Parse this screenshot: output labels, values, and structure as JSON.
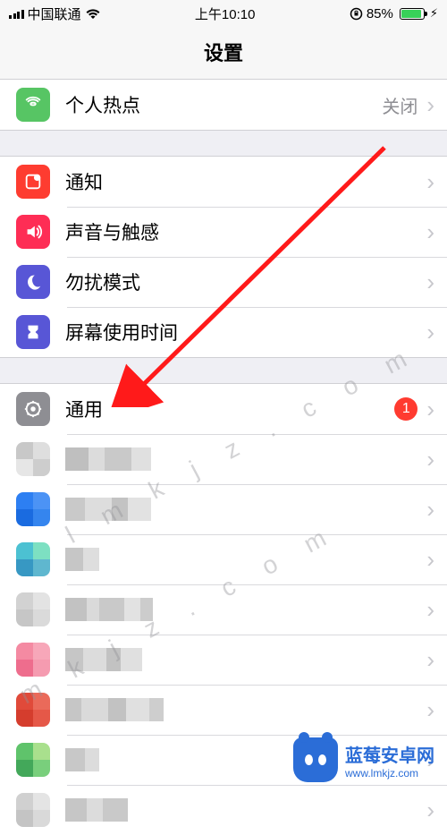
{
  "status": {
    "carrier": "中国联通",
    "time": "上午10:10",
    "battery_percent": "85%"
  },
  "nav": {
    "title": "设置"
  },
  "group_hotspot": {
    "label": "个人热点",
    "value": "关闭"
  },
  "group_notifications": [
    {
      "label": "通知"
    },
    {
      "label": "声音与触感"
    },
    {
      "label": "勿扰模式"
    },
    {
      "label": "屏幕使用时间"
    }
  ],
  "group_general": {
    "label": "通用",
    "badge": "1"
  },
  "watermark": {
    "brand_cn": "蓝莓安卓网",
    "brand_url": "www.lmkjz.com"
  }
}
